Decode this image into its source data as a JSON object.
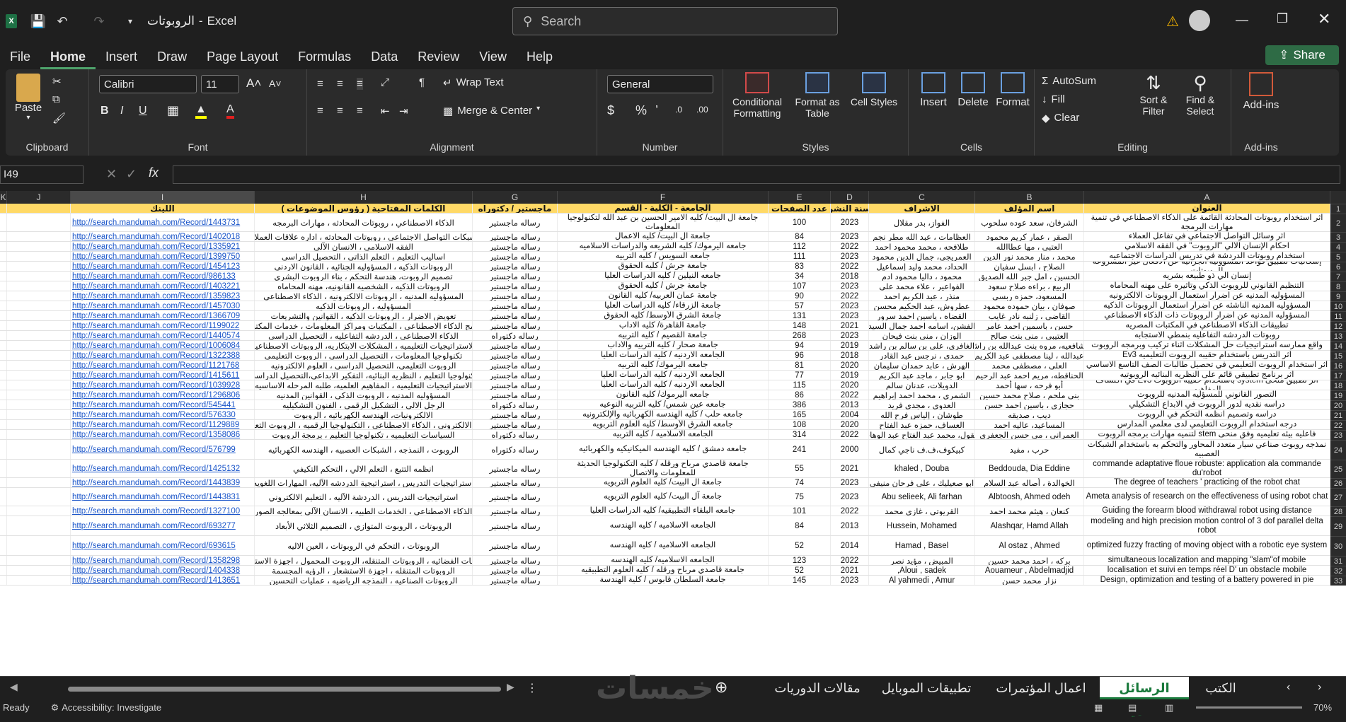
{
  "titlebar": {
    "doc_title": "الروبوتات",
    "app_name": "Excel",
    "separator": "-",
    "search_placeholder": "Search"
  },
  "menu": [
    "File",
    "Home",
    "Insert",
    "Draw",
    "Page Layout",
    "Formulas",
    "Data",
    "Review",
    "View",
    "Help"
  ],
  "share_label": "Share",
  "ribbon": {
    "clipboard": {
      "label": "Clipboard",
      "paste": "Paste"
    },
    "font": {
      "label": "Font",
      "family": "Calibri",
      "size": "11"
    },
    "alignment": {
      "label": "Alignment",
      "wrap": "Wrap Text",
      "merge": "Merge & Center"
    },
    "number": {
      "label": "Number",
      "format": "General"
    },
    "styles": {
      "label": "Styles",
      "conditional": "Conditional Formatting",
      "format_table": "Format as Table",
      "cell_styles": "Cell Styles"
    },
    "cells": {
      "label": "Cells",
      "insert": "Insert",
      "delete": "Delete",
      "format": "Format"
    },
    "editing": {
      "label": "Editing",
      "autosum": "AutoSum",
      "fill": "Fill",
      "clear": "Clear",
      "sort": "Sort & Filter",
      "find": "Find & Select"
    },
    "addins": {
      "label": "Add-ins",
      "addins": "Add-ins"
    }
  },
  "namebox": "I49",
  "columns": [
    {
      "id": "K"
    },
    {
      "id": "J"
    },
    {
      "id": "I"
    },
    {
      "id": "H"
    },
    {
      "id": "G"
    },
    {
      "id": "F"
    },
    {
      "id": "E"
    },
    {
      "id": "D"
    },
    {
      "id": "C"
    },
    {
      "id": "B"
    },
    {
      "id": "A"
    }
  ],
  "headers": {
    "A": "العنوان",
    "B": "اسم المؤلف",
    "C": "الاشراف",
    "D": "سنة النشر",
    "E": "عدد الصفحات",
    "F": "الجامعة - الكلية - القسم",
    "G": "ماجستير / دكتوراه",
    "H": "الكلمات المفتاحية ( رؤوس الموضوعات )",
    "I": "اللينك"
  },
  "rows": [
    {
      "n": "2",
      "A": "اثر استخدام روبوتات المحادثة القائمة على الذكاء الاصطناعي في تنمية مهارات البرمجة",
      "B": "الشرفان، سعد عوده سلحوب",
      "C": "الفواز، بدر مقلال",
      "D": "2023",
      "E": "100",
      "F": "جامعة آل البيت/ كليه الامير الحسين بن عبد الله لتكنولوجيا المعلومات",
      "G": "رساله ماجستير",
      "H": "الذكاء الاصطناعي ، روبوتات المحادثه ، مهارات البرمجه",
      "I": "http://search.mandumah.com/Record/1443731"
    },
    {
      "n": "3",
      "A": "اثر وسائل التواصل الاجتماعي في تفاعل العملاء",
      "B": "الصقر ، عمار كريم محمود",
      "C": "العظامات ، عبد الله مطر نجم",
      "D": "2023",
      "E": "84",
      "F": "جامعة آل البيت/ كليه الاعمال",
      "G": "رساله ماجستير",
      "H": "شبكات التواصل الاجتماعي ، روبوتات المحادثه ، اداره علاقات العملاء",
      "I": "http://search.mandumah.com/Record/1402018"
    },
    {
      "n": "4",
      "A": "احكام الإنسان الآلي \"الروبوت\" في الفقه الاسلامي",
      "B": "العتبي ، مها عطاالله",
      "C": "طلافحه ، محمد محمود احمد",
      "D": "2022",
      "E": "112",
      "F": "جامعه اليرموك/ كليه الشريعه والدراسات الاسلاميه",
      "G": "رساله ماجستير",
      "H": "الفقه الاسلامي ، الانسان الآلي",
      "I": "http://search.mandumah.com/Record/1335921"
    },
    {
      "n": "5",
      "A": "استخدام روبوتات الدردشة في تدريس الدراسات الاجتماعيه",
      "B": "محمد ، منار محمد نور الدين",
      "C": "العمريجي، جمال الدين محمود",
      "D": "2023",
      "E": "111",
      "F": "جامعه السويس / كليه التربيه",
      "G": "رساله ماجستير",
      "H": "اساليب التعليم ، التعلم الذاتي ، التحصيل الدراسي",
      "I": "http://search.mandumah.com/Record/1399750"
    },
    {
      "n": "6",
      "A": "إشكاليات تطبيق قواعد المسؤولية الجزائية عن الافعال غير المشروعة للروبوتات",
      "B": "الصلاح ، ابسل سفيان",
      "C": "الحداد، محمد وليد إسماعيل",
      "D": "2022",
      "E": "83",
      "F": "جامعة جرش / كليه الحقوق",
      "G": "رساله ماجستير",
      "H": "الروبوتات الذكيه ، المسؤوليه الجنائيه ، القانون الاردني",
      "I": "http://search.mandumah.com/Record/1454123"
    },
    {
      "n": "7",
      "A": "إنسان آلي ذو طبيعه بشريه",
      "B": "الحسين ، امل جبر الله الصديق",
      "C": "محمود ، داليا محمود ادم",
      "D": "2018",
      "E": "34",
      "F": "جامعه النيلين / كليه الدراسات العليا",
      "G": "رساله ماجستير",
      "H": "تصميم الروبوت، هندسة التحكم ، بناء الروبوت البشري",
      "I": "http://search.mandumah.com/Record/986133"
    },
    {
      "n": "8",
      "A": "التنظيم القانوني للروبوت الذكي وتأثيره على مهنه المحاماه",
      "B": "الربيع ، براءه صلاح سعود",
      "C": "الفواعير ، علاء محمد علي",
      "D": "2023",
      "E": "107",
      "F": "جامعة جرش / كليه الحقوق",
      "G": "رساله ماجستير",
      "H": "الروبوتات الذكيه ، الشخصيه القانونيه، مهنه المحاماه",
      "I": "http://search.mandumah.com/Record/1403221"
    },
    {
      "n": "9",
      "A": "المسؤوليه المدنيه عن أضرار استعمال الروبوتات الالكترونيه",
      "B": "المسعود، حمزه ربسي",
      "C": "منذر ، عبد الكريم احمد",
      "D": "2022",
      "E": "90",
      "F": "جامعة عمان العربيه/ كليه القانون",
      "G": "رساله ماجستير",
      "H": "المسؤوليه المدنيه ، الروبوتات الالكترونيه ، الذكاء الاصطناعي",
      "I": "http://search.mandumah.com/Record/1359823"
    },
    {
      "n": "10",
      "A": "المسؤوليه المدنيه الناشئه عن أضرار استعمال الروبوتات الذكيه",
      "B": "صوفان ، بيان حموده محمود",
      "C": "عطروش، عبد الحكيم محسن",
      "D": "2023",
      "E": "57",
      "F": "جامعة الزرقاء/ كليه الدراسات العليا",
      "G": "رساله ماجستير",
      "H": "المسؤوليه ، الروبوتات الذكيه",
      "I": "http://search.mandumah.com/Record/1457030"
    },
    {
      "n": "11",
      "A": "المسؤوليه المدنيه عن أضرار الروبوتات ذات الذكاء الاصطناعي",
      "B": "القاضي ، زلنبه نادر غايب",
      "C": "القضاه ، ياسين احمد سرور",
      "D": "2023",
      "E": "131",
      "F": "جامعة الشرق الأوسط/ كليه الحقوق",
      "G": "رساله ماجستير",
      "H": "تعويض الاضرار ، الروبوتات الذكيه ، القوانين والتشريعات",
      "I": "http://search.mandumah.com/Record/1366709"
    },
    {
      "n": "12",
      "A": "تطبيقات الذكاء الاصطناعي في المكتبات المصريه",
      "B": "حسن ، باسمين احمد عامر",
      "C": "الفشن، اسامه احمد جمال السيد",
      "D": "2021",
      "E": "148",
      "F": "جامعة القاهرة/ كليه الاداب",
      "G": "رساله ماجستير",
      "H": "برامج الذكاء الاصطناعي ، المكتبات ومراكز المعلومات ، خدمات المكتبات",
      "I": "http://search.mandumah.com/Record/1199022"
    },
    {
      "n": "13",
      "A": "روبوتات الدردشه التفاعليه بنمطي الاستجابه",
      "B": "العتيبي ، مني بنت صالح",
      "C": "الوزان ، مني بنت فيحان",
      "D": "2023",
      "E": "268",
      "F": "جامعة القصيم / كليه التربيه",
      "G": "رساله دكتوراه",
      "H": "الذكاء الاصطناعي ، الدردشه التفاعليه ، التحصيل الدراسي",
      "I": "http://search.mandumah.com/Record/1440574"
    },
    {
      "n": "14",
      "A": "واقع ممارسه استراتيجيات حل المشكلات اثناء تركيب وبرمجه الروبوت",
      "B": "الشافعيه، مروه بنت عبدالله بن راشد",
      "C": "الغافري، علي بن سالم بن راشد",
      "D": "2019",
      "E": "94",
      "F": "جامعة صحار / كليه التربيه والآداب",
      "G": "رساله ماجستير",
      "H": "الاستراتيجيات التعليميه ، المشكلات الابتكاريه، الروبوتات الاصطناعيه",
      "I": "http://search.mandumah.com/Record/1006084"
    },
    {
      "n": "15",
      "A": "أثر التدريس باستخدام حقيبه الروبوت التعليميه Ev3",
      "B": "عبدالله ، لينا مصطفى عبد الكريم",
      "C": "حمدى ، نرجس عبد القادر",
      "D": "2018",
      "E": "96",
      "F": "الجامعه الاردنيه / كليه الدراسات العليا",
      "G": "رساله ماجستير",
      "H": "تكنولوجيا المعلومات ، التحصيل الدراسي ، الروبوت التعليمي",
      "I": "http://search.mandumah.com/Record/1322388"
    },
    {
      "n": "16",
      "A": "اثر استخدام الروبوت التعليمي في تحصيل طالبات الصف التاسع الاساسي",
      "B": "العلي ، مصطفى محمد",
      "C": "الهرش ، عابد حمدان سليمان",
      "D": "2020",
      "E": "81",
      "F": "جامعه اليرموك/ كليه التربيه",
      "G": "رساله ماجستير",
      "H": "الروبوت التعليمي، التحصيل الدراسي ، العلوم الالكترونيه",
      "I": "http://search.mandumah.com/Record/1121768"
    },
    {
      "n": "17",
      "A": "أثر برنامج تطبيقي قائم على النظريه البنائيه الروبوتيه",
      "B": "الحناقطه، مريم احمد عبد الرحيم",
      "C": "ابو جابر ، ماجد عبد الكريم",
      "D": "2019",
      "E": "77",
      "F": "الجامعه الاردنيه / كليه الدراسات العليا",
      "G": "رساله ماجستير",
      "H": "تكنولوجيا التعليم ، النظريه البنائيه، التفكير الابداعي،التحصيل الدراسي",
      "I": "http://search.mandumah.com/Record/1415611"
    },
    {
      "n": "18",
      "A": "أثر تطبيق منحى system باستخدام حقيبه الروبوت Ev3 في اكتشاف المفاهيم",
      "B": "أبو فرحه ، سها أحمد",
      "C": "الدويلات، عدنان سالم",
      "D": "2020",
      "E": "115",
      "F": "الجامعه الاردنيه / كليه الدراسات العليا",
      "G": "رساله ماجستير",
      "H": "الاستراتيجيات التعليميه ، المفاهيم العلميه، طلبه المرحله الاساسيه",
      "I": "http://search.mandumah.com/Record/1039928"
    },
    {
      "n": "19",
      "A": "التصور القانوني للمسؤليه المدنيه للروبوت",
      "B": "بني ملحم ، صلاح محمد حسين",
      "C": "الشمري ، محمد احمد إبراهيم",
      "D": "2022",
      "E": "86",
      "F": "جامعه اليرموك/ كليه القانون",
      "G": "رساله ماجستير",
      "H": "المسؤوليه المدنيه ، الروبوت الذكي ، القوانين المدنيه",
      "I": "http://search.mandumah.com/Record/1296806"
    },
    {
      "n": "20",
      "A": "دراسه نقديه لدور الروبوت في الابداع التشكيلي",
      "B": "حجازي ، باسين احمد حسن",
      "C": "العدوي ، مجدي فريد",
      "D": "2013",
      "E": "386",
      "F": "جامعه عين شمس/ كليه التربيه النوعيه",
      "G": "رساله دكتوراه",
      "H": "الرجل الالى ، التشكيل الرقمى ، الفنون التشكيليه",
      "I": "http://search.mandumah.com/Record/545441"
    },
    {
      "n": "21",
      "A": "دراسه وتصميم انظمه التحكم في الروبوت",
      "B": "ديب ، صديقه",
      "C": "طوشان ، إلياس فرح الله",
      "D": "2004",
      "E": "165",
      "F": "جامعه حلب / كليه الهندسه الكهربائيه والإلكترونيه",
      "G": "رساله ماجستير",
      "H": "الالكترونيات، الهندسه الكهربائيه ، الروبوت",
      "I": "http://search.mandumah.com/Record/576330"
    },
    {
      "n": "22",
      "A": "درجه استخدام الروبوت التعليمي لدى معلمي المدارس",
      "B": "المساعيد، عاليه احمد",
      "C": "العساف، حمزه عبد الفتاح",
      "D": "2020",
      "E": "108",
      "F": "جامعه الشرق الأوسط/ كليه العلوم التربويه",
      "G": "رساله ماجستير",
      "H": "تعلم الالكتروني ، الذكاء الاصطناعي ، التكنولوجيا الرقميه ، الروبوت التعليمي",
      "I": "http://search.mandumah.com/Record/1129889"
    },
    {
      "n": "23",
      "A": "فاعليه بيئه تعليميه وفق منحى stem لتنميه مهارات برمجه الروبوت",
      "B": "العمراني ، مي حسن الجعفري",
      "C": "سقول، محمد عبد الفتاح عبد الوهاب",
      "D": "2022",
      "E": "314",
      "F": "الجامعه الاسلاميه / كليه التربيه",
      "G": "رساله دكتوراه",
      "H": "السياسات التعليميه ، تكنولوجيا التعليم ، برمجة الروبوت",
      "I": "http://search.mandumah.com/Record/1358086"
    },
    {
      "n": "24",
      "A": "نمذجه روبوت صناعي سيار متعدد المحاور والتحكم به باستخدام الشبكات العصبيه",
      "B": "حرب ، مفيد",
      "C": "كبيكوف،ف.ف ناجي كمال",
      "D": "2000",
      "E": "241",
      "F": "جامعه دمشق / كليه الهندسه الميكانيكيه والكهربائيه",
      "G": "رساله دكتوراه",
      "H": "الروبوت ، النمذجه ، الشبكات العصبيه ، الهندسه الكهربائيه",
      "I": "http://search.mandumah.com/Record/576799"
    },
    {
      "n": "25",
      "A": "commande adaptative floue robuste: application ala commande du'robot",
      "B": "Beddouda, Dia Eddine",
      "C": "khaled , Douba",
      "D": "2021",
      "E": "55",
      "F": "جامعة قاصدي مرباح ورقله / كليه التكنولوجيا الحديثة للمعلومات والاتصال",
      "G": "رساله ماجستير",
      "H": "انظمه التتبع ، التعلم الالي ، التحكم التكيفي",
      "I": "http://search.mandumah.com/Record/1425132"
    },
    {
      "n": "26",
      "A": "The degree of teachers ' practicing of the robot chat",
      "B": "الخوالدة ، أصاله عبد السلام",
      "C": "ابو صعيليك ، علي فرحان منيفي",
      "D": "2023",
      "E": "74",
      "F": "جامعة آل البيت/ كليه العلوم التربويه",
      "G": "رساله ماجستير",
      "H": "استراتيجيات التدريس ، استراتيجية الدردشه الآليه، المهارات اللغويه",
      "I": "http://search.mandumah.com/Record/1443839"
    },
    {
      "n": "27",
      "A": "Ameta analysis of research on the effectiveness of using robot chat",
      "B": "Albtoosh, Ahmed odeh",
      "C": "Abu selieek, Ali farhan",
      "D": "2023",
      "E": "75",
      "F": "جامعة آل البيت/ كليه العلوم التربويه",
      "G": "رساله ماجستير",
      "H": "استراتيجيات التدريس ، الدردشة الآليه ، التعليم الالكتروني",
      "I": "http://search.mandumah.com/Record/1443831"
    },
    {
      "n": "28",
      "A": "Guiding the forearm blood withdrawal robot using distance",
      "B": "كنعان ، هيثم محمد احمد",
      "C": "القريوتي ، غازي محمد",
      "D": "2022",
      "E": "101",
      "F": "جامعه البلقاء التطبيقيه/ كليه الدراسات العليا",
      "G": "رساله ماجستير",
      "H": "الذكاء الاصطناعي ، الخدمات الطبيه ، الانسان الآلي بمعالجه الصور",
      "I": "http://search.mandumah.com/Record/1327100"
    },
    {
      "n": "29",
      "A": "modeling and high precision motion control of 3 dof parallel delta robot",
      "B": "Alashqar, Hamd Allah",
      "C": "Hussein, Mohamed",
      "D": "2013",
      "E": "84",
      "F": "الجامعه الاسلاميه / كليه الهندسه",
      "G": "رساله ماجستير",
      "H": "الروبوتات ، الروبوت المتوازي ، التصميم الثلاثي الأبعاد",
      "I": "http://search.mandumah.com/Record/693277"
    },
    {
      "n": "30",
      "A": "optimized fuzzy fracting of moving object with a robotic eye system",
      "B": "Al ostaz , Ahmed",
      "C": "Hamad , Basel",
      "D": "2014",
      "E": "52",
      "F": "الجامعه الاسلاميه / كليه الهندسه",
      "G": "رساله ماجستير",
      "H": "الروبوتات ، التحكم في الروبوتات ، العين الاليه",
      "I": "http://search.mandumah.com/Record/693615"
    },
    {
      "n": "31",
      "A": "simultaneous localization and mapping \"slam\"of mobile",
      "B": "بركه ، احمد محمد حسين",
      "C": "المبيض ، مؤيد نصر",
      "D": "2022",
      "E": "123",
      "F": "الجامعه الاسلاميه/ كليه الهندسه",
      "G": "رساله ماجستير",
      "H": "تطبيقات الفضائيه ، الروبوتات المتنقله، الروبوت المحمول ، اجهزة الاستشعار",
      "I": "http://search.mandumah.com/Record/1358298"
    },
    {
      "n": "32",
      "A": "localisation et suivi en temps réel D' un obstacle mobile",
      "B": "Aouameur , Abdelmadjid",
      "C": "Aloui , sadek,",
      "D": "2021",
      "E": "52",
      "F": "جامعة قاصدي مرباح ورقله / كليه العلوم التطبيقيه",
      "G": "رساله ماجستير",
      "H": "الروبوتات المتنقله ، اجهزة الاستشعار ، الرؤيه المجسمة",
      "I": "http://search.mandumah.com/Record/1404338"
    },
    {
      "n": "33",
      "A": "Design, optimization and testing of a battery powered in pie",
      "B": "نزار محمد حسن",
      "C": "Al yahmedi , Amur",
      "D": "2023",
      "E": "145",
      "F": "جامعة السلطان قابوس / كلية الهندسة",
      "G": "رساله ماجستير",
      "H": "الروبوتات الصناعيه ، النمذجه الرياضيه ، عمليات التحسين",
      "I": "http://search.mandumah.com/Record/1413651"
    }
  ],
  "sheet_tabs": [
    "الرسائل العلمية",
    "اعمال المؤتمرات",
    "تطبيقات الموبايل",
    "مقالات الدوريات",
    "الكتب"
  ],
  "active_tab": "الرسائل العلمية",
  "watermark": "خمسات",
  "status": {
    "ready": "Ready",
    "accessibility": "Accessibility: Investigate",
    "zoom": "70%"
  }
}
